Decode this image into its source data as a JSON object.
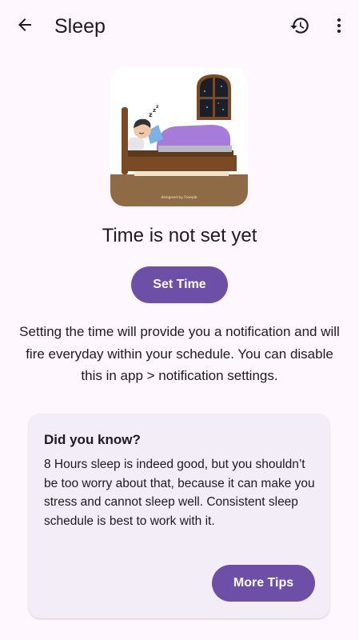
{
  "topbar": {
    "title": "Sleep",
    "back_icon": "arrow-back-icon",
    "history_icon": "history-icon",
    "more_icon": "more-vert-icon"
  },
  "illustration": {
    "credit": "designed by Freepik"
  },
  "status": {
    "headline": "Time is not set yet"
  },
  "actions": {
    "set_time_label": "Set Time"
  },
  "description": "Setting the time will provide you a notification and will fire everyday within your schedule. You can disable this in app > notification settings.",
  "tips_card": {
    "title": "Did you know?",
    "body": "8 Hours sleep is indeed good, but you shouldn’t be too worry about that, because it can make you stress and cannot sleep well. Consistent sleep schedule is best to work with it.",
    "button_label": "More Tips"
  },
  "colors": {
    "background": "#fef7fe",
    "primary": "#6d4fa8",
    "card": "#f3edf7",
    "text": "#1d1b20"
  }
}
